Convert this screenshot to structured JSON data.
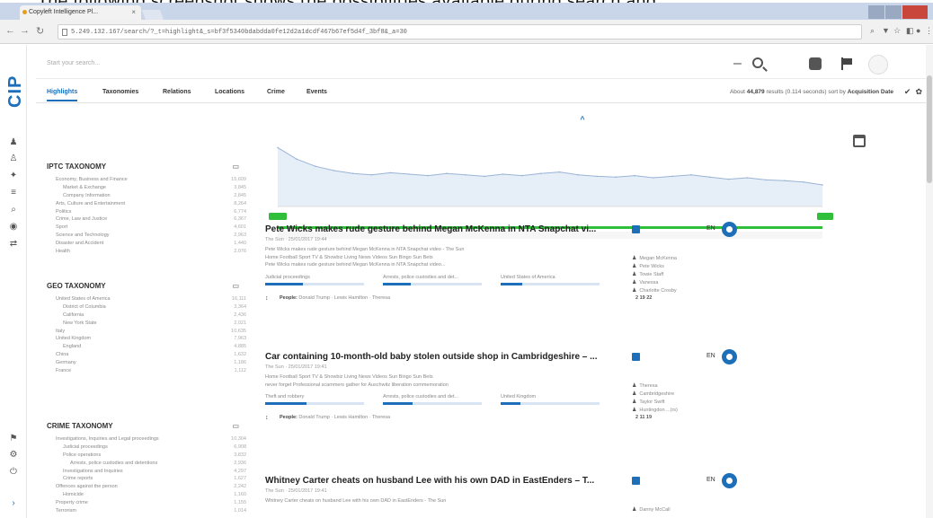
{
  "caption": "The following screenshot shows the possibilities available during search and",
  "browser": {
    "tab_title": "Copyleft Intelligence Pl...",
    "url": "5.249.132.167/search/?_t=highlight&_s=bf3f5340bdabdda0fe12d2a1dcdf467b67ef5d4f_3bf8&_a=30"
  },
  "app": {
    "logo": "CIP",
    "search_placeholder": "Start your search...",
    "tabs": [
      "Highlights",
      "Taxonomies",
      "Relations",
      "Locations",
      "Crime",
      "Events"
    ],
    "results": {
      "prefix": "About",
      "count": "44,879",
      "suffix": "results (0.114 seconds) sort by",
      "sort": "Acquisition Date"
    }
  },
  "taxonomies": [
    {
      "title": "IPTC TAXONOMY",
      "rows": [
        {
          "label": "Economy, Business and Finance",
          "count": "15,609",
          "indent": 0
        },
        {
          "label": "Market & Exchange",
          "count": "3,845",
          "indent": 1
        },
        {
          "label": "Company Information",
          "count": "2,845",
          "indent": 1
        },
        {
          "label": "Arts, Culture and Entertainment",
          "count": "8,264",
          "indent": 0
        },
        {
          "label": "Politics",
          "count": "6,774",
          "indent": 0
        },
        {
          "label": "Crime, Law and Justice",
          "count": "6,367",
          "indent": 0
        },
        {
          "label": "Sport",
          "count": "4,601",
          "indent": 0
        },
        {
          "label": "Science and Technology",
          "count": "2,963",
          "indent": 0
        },
        {
          "label": "Disaster and Accident",
          "count": "1,440",
          "indent": 0
        },
        {
          "label": "Health",
          "count": "2,076",
          "indent": 0
        }
      ]
    },
    {
      "title": "GEO TAXONOMY",
      "rows": [
        {
          "label": "United States of America",
          "count": "16,111",
          "indent": 0
        },
        {
          "label": "District of Columbia",
          "count": "3,364",
          "indent": 1
        },
        {
          "label": "California",
          "count": "2,436",
          "indent": 1
        },
        {
          "label": "New York State",
          "count": "2,021",
          "indent": 1
        },
        {
          "label": "Italy",
          "count": "10,635",
          "indent": 0
        },
        {
          "label": "United Kingdom",
          "count": "7,963",
          "indent": 0
        },
        {
          "label": "England",
          "count": "4,885",
          "indent": 1
        },
        {
          "label": "China",
          "count": "1,632",
          "indent": 0
        },
        {
          "label": "Germany",
          "count": "1,186",
          "indent": 0
        },
        {
          "label": "France",
          "count": "1,112",
          "indent": 0
        }
      ]
    },
    {
      "title": "CRIME TAXONOMY",
      "rows": [
        {
          "label": "Investigations, Inquiries and Legal proceedings",
          "count": "10,304",
          "indent": 0
        },
        {
          "label": "Judicial proceedings",
          "count": "6,908",
          "indent": 1
        },
        {
          "label": "Police operations",
          "count": "3,832",
          "indent": 1
        },
        {
          "label": "Arrests, police custodies and detentions",
          "count": "2,936",
          "indent": 2
        },
        {
          "label": "Investigations and Inquiries",
          "count": "4,297",
          "indent": 1
        },
        {
          "label": "Crime reports",
          "count": "1,627",
          "indent": 1
        },
        {
          "label": "Offences against the person",
          "count": "2,242",
          "indent": 0
        },
        {
          "label": "Homicide",
          "count": "1,160",
          "indent": 1
        },
        {
          "label": "Property crime",
          "count": "1,155",
          "indent": 0
        },
        {
          "label": "Terrorism",
          "count": "1,014",
          "indent": 0
        }
      ]
    }
  ],
  "chart_data": {
    "type": "area",
    "x_ticks": [
      "",
      "",
      "",
      "",
      "",
      "",
      "",
      "",
      "",
      "",
      ""
    ],
    "values": [
      82,
      66,
      56,
      50,
      46,
      44,
      47,
      45,
      43,
      46,
      44,
      42,
      45,
      43,
      46,
      48,
      44,
      42,
      41,
      43,
      40,
      42,
      44,
      41,
      38,
      40,
      37,
      36,
      34,
      30
    ],
    "ylim": [
      0,
      100
    ],
    "range_start_label": "",
    "range_end_label": ""
  },
  "articles": [
    {
      "title": "Pete Wicks makes rude gesture behind Megan McKenna in NTA Snapchat vi...",
      "source": "The Sun  ·  25/01/2017 19:44",
      "snippets": [
        "Pete Wicks makes rude gesture behind Megan McKenna in NTA Snapchat video - The Sun",
        "Home Football Sport TV & Showbiz Living News Videos Sun Bingo Sun Bets",
        "Pete Wicks makes rude gesture behind Megan McKenna in NTA Snapchat video..."
      ],
      "categories": [
        {
          "label": "Judicial proceedings",
          "level": 0.38
        },
        {
          "label": "Arrests, police custodies and det...",
          "level": 0.28
        },
        {
          "label": "United States of America",
          "level": 0.22
        }
      ],
      "people_label": "People:",
      "people": "Donald Trump · Lewis Hamilton · Theresa",
      "entities": [
        "Megan McKenna",
        "Pete Wicks",
        "Towie Staff",
        "Vanessa",
        "Charlotte Crosby"
      ],
      "stats": "2   19   22",
      "lang": "EN"
    },
    {
      "title": "Car containing 10-month-old baby stolen outside shop in Cambridgeshire – ...",
      "source": "The Sun  ·  25/01/2017 19:41",
      "snippets": [
        "Home Football Sport TV & Showbiz Living News Videos Sun Bingo Sun Bets",
        "never forget Professional scammers gather for Auschwitz liberation commemoration"
      ],
      "categories": [
        {
          "label": "Theft and robbery",
          "level": 0.42
        },
        {
          "label": "Arrests, police custodies and det...",
          "level": 0.3
        },
        {
          "label": "United Kingdom",
          "level": 0.2
        }
      ],
      "people_label": "People:",
      "people": "Donald Trump · Lewis Hamilton · Theresa",
      "entities": [
        "Theresa",
        "Cambridgeshire",
        "Taylor Swift",
        "Huntingdon ...(rs)"
      ],
      "stats": "2   11   19",
      "lang": "EN"
    },
    {
      "title": "Whitney Carter cheats on husband Lee with his own DAD in EastEnders – T...",
      "source": "The Sun  ·  25/01/2017 19:41",
      "snippets": [
        "Whitney Carter cheats on husband Lee with his own DAD in EastEnders - The Sun"
      ],
      "categories": [],
      "people_label": "",
      "people": "",
      "entities": [
        "Danny McCall"
      ],
      "stats": "",
      "lang": "EN"
    }
  ],
  "colors": {
    "accent": "#1c6fb8",
    "range_green": "#2fbf3a",
    "chart_fill": "#e6eef8"
  }
}
